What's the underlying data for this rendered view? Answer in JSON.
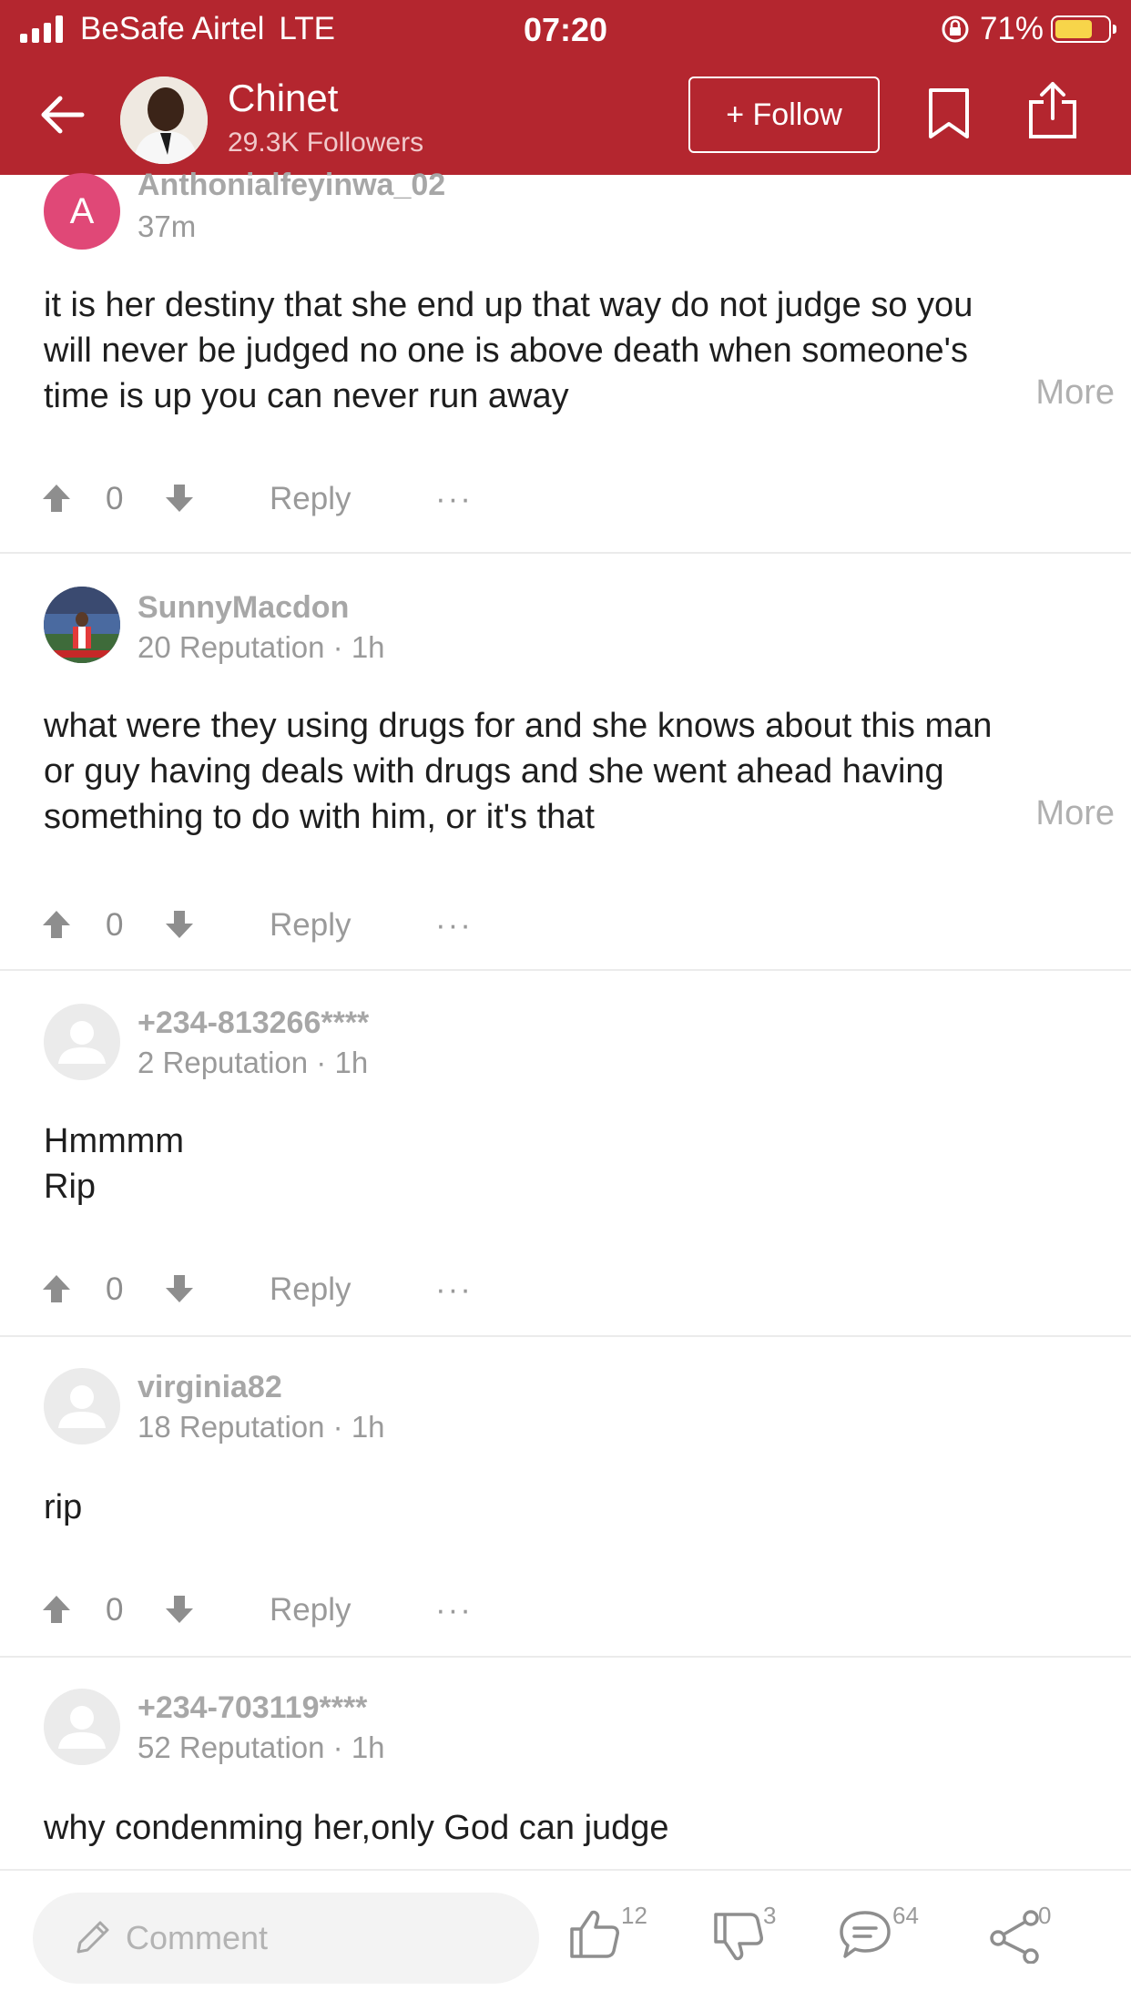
{
  "status": {
    "carrier": "BeSafe Airtel",
    "network": "LTE",
    "time": "07:20",
    "battery": "71%"
  },
  "header": {
    "name": "Chinet",
    "followers": "29.3K Followers",
    "follow_label": "+ Follow"
  },
  "comments": [
    {
      "avatar_letter": "A",
      "name": "Anthonialfeyinwa_02",
      "meta": "37m",
      "body": "it is her destiny that she end up that way do not judge so you will never be judged no one is above death when someone's time is up you can never run away",
      "more": "More",
      "votes": "0",
      "reply": "Reply",
      "dots": "···"
    },
    {
      "name": "SunnyMacdon",
      "meta": "20 Reputation · 1h",
      "body": "what were they using drugs for and she knows about this man or guy having deals with drugs and she went ahead having something to do with him, or it's that",
      "more": "More",
      "votes": "0",
      "reply": "Reply",
      "dots": "···"
    },
    {
      "name": "+234-813266****",
      "meta": "2 Reputation · 1h",
      "body": "Hmmmm\nRip",
      "votes": "0",
      "reply": "Reply",
      "dots": "···"
    },
    {
      "name": "virginia82",
      "meta": "18 Reputation · 1h",
      "body": "rip",
      "votes": "0",
      "reply": "Reply",
      "dots": "···"
    },
    {
      "name": "+234-703119****",
      "meta": "52 Reputation · 1h",
      "body": "why condenming her,only God can judge"
    }
  ],
  "bottom": {
    "comment_placeholder": "Comment",
    "likes": "12",
    "dislikes": "3",
    "comments": "64",
    "shares": "0"
  },
  "colors": {
    "brand_red": "#b4262f",
    "battery_yellow": "#f7d54a",
    "avatar_pink": "#e04877"
  }
}
